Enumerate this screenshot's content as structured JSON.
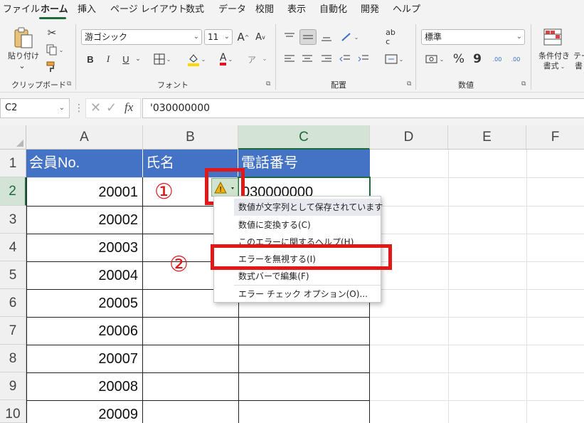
{
  "menu": {
    "items": [
      "ファイル",
      "ホーム",
      "挿入",
      "ページ レイアウト",
      "数式",
      "データ",
      "校閲",
      "表示",
      "自動化",
      "開発",
      "ヘルプ"
    ],
    "active": "ホーム"
  },
  "ribbon": {
    "clipboard": {
      "paste_label": "貼り付け",
      "group_label": "クリップボード"
    },
    "font": {
      "font_name": "游ゴシック",
      "font_size": "11",
      "group_label": "フォント",
      "increase_label": "A",
      "decrease_label": "A",
      "bold": "B",
      "italic": "I",
      "underline": "U",
      "font_color_label": "A"
    },
    "alignment": {
      "group_label": "配置"
    },
    "number": {
      "format": "標準",
      "percent": "%",
      "comma": "9",
      "group_label": "数値",
      "inc_decimal": ".00",
      "dec_decimal": ".00"
    },
    "styles": {
      "conditional_format_label1": "条件付き",
      "conditional_format_label2": "書式",
      "table_label1": "テー",
      "table_label2": "書"
    }
  },
  "formula_bar": {
    "name_box": "C2",
    "fx_label": "fx",
    "formula": "'030000000"
  },
  "grid": {
    "columns": [
      "A",
      "B",
      "C",
      "D",
      "E",
      "F"
    ],
    "rows": [
      "1",
      "2",
      "3",
      "4",
      "5",
      "6",
      "7",
      "8",
      "9",
      "10"
    ],
    "selected_column": "C",
    "selected_row": "2",
    "header_row": [
      "会員No.",
      "氏名",
      "電話番号"
    ],
    "member_numbers": [
      "20001",
      "20002",
      "20003",
      "20004",
      "20005",
      "20006",
      "20007",
      "20008",
      "20009"
    ],
    "c2_value": "030000000"
  },
  "error_menu": {
    "items": [
      "数値が文字列として保存されています",
      "数値に変換する(C)",
      "このエラーに関するヘルプ(H)",
      "エラーを無視する(I)",
      "数式バーで編集(F)",
      "エラー チェック オプション(O)..."
    ]
  },
  "annotations": {
    "marker1": "①",
    "marker2": "②"
  },
  "colors": {
    "header_fill": "#4472c4",
    "accent": "#1d6b3a",
    "highlight": "#e01818"
  }
}
